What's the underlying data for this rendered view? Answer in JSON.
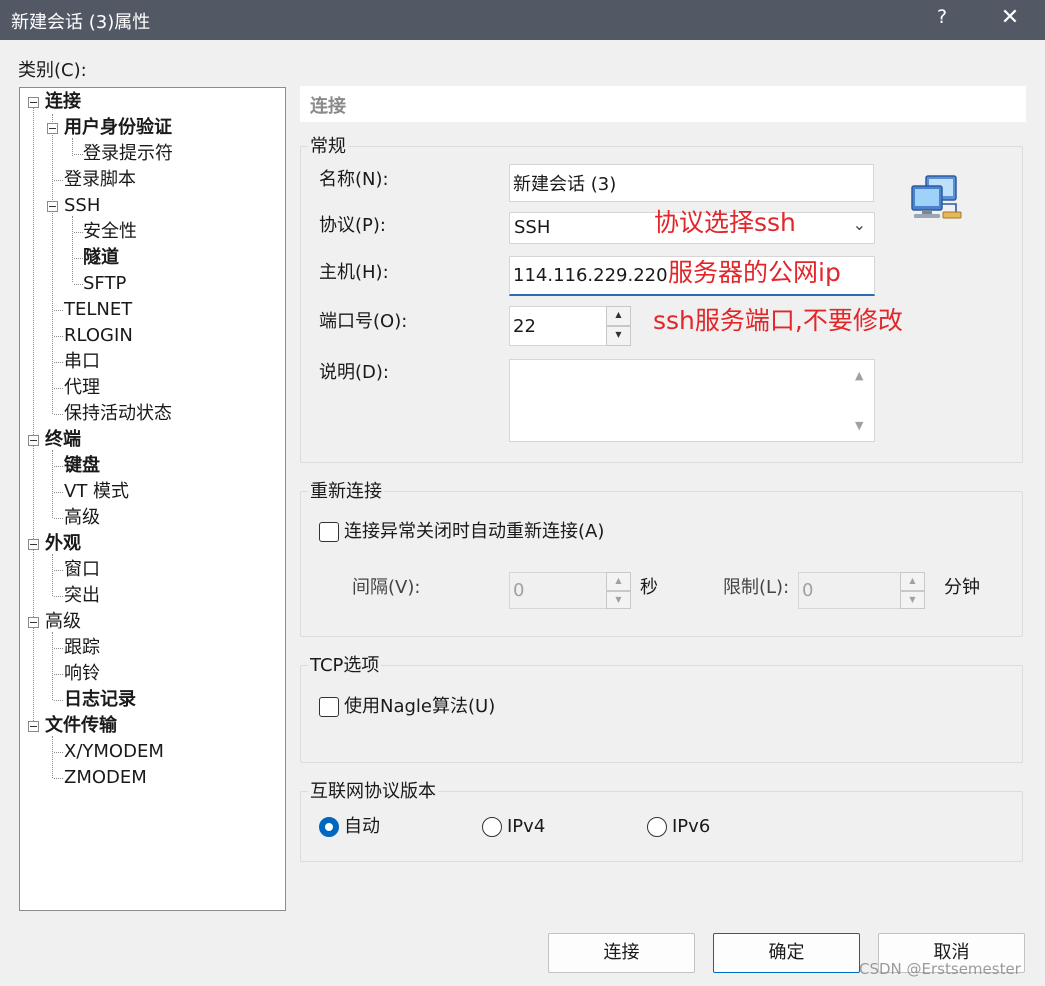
{
  "window": {
    "title": "新建会话 (3)属性",
    "help_label": "?",
    "close_label": "✕"
  },
  "category_label": "类别(C):",
  "tree": {
    "connection": "连接",
    "auth": "用户身份验证",
    "login_prompt": "登录提示符",
    "login_script": "登录脚本",
    "ssh": "SSH",
    "security": "安全性",
    "tunnel": "隧道",
    "sftp": "SFTP",
    "telnet": "TELNET",
    "rlogin": "RLOGIN",
    "serial": "串口",
    "proxy": "代理",
    "keepalive": "保持活动状态",
    "terminal": "终端",
    "keyboard": "键盘",
    "vt_mode": "VT 模式",
    "term_advanced": "高级",
    "appearance": "外观",
    "window": "窗口",
    "highlight": "突出",
    "advanced": "高级",
    "trace": "跟踪",
    "bell": "响铃",
    "logging": "日志记录",
    "file_transfer": "文件传输",
    "xymodem": "X/YMODEM",
    "zmodem": "ZMODEM"
  },
  "page": {
    "header": "连接",
    "general": {
      "legend": "常规",
      "name_label": "名称(N):",
      "name_value": "新建会话 (3)",
      "protocol_label": "协议(P):",
      "protocol_value": "SSH",
      "host_label": "主机(H):",
      "host_value": "114.116.229.220",
      "port_label": "端口号(O):",
      "port_value": "22",
      "desc_label": "说明(D):",
      "desc_value": ""
    },
    "reconnect": {
      "legend": "重新连接",
      "auto_reconnect_label": "连接异常关闭时自动重新连接(A)",
      "auto_reconnect_checked": false,
      "interval_label": "间隔(V):",
      "interval_value": "0",
      "interval_unit": "秒",
      "limit_label": "限制(L):",
      "limit_value": "0",
      "limit_unit": "分钟"
    },
    "tcp": {
      "legend": "TCP选项",
      "nagle_label": "使用Nagle算法(U)",
      "nagle_checked": false
    },
    "ip_version": {
      "legend": "互联网协议版本",
      "options": [
        "自动",
        "IPv4",
        "IPv6"
      ],
      "selected": "自动"
    }
  },
  "annotations": {
    "protocol_note": "协议选择ssh",
    "host_note": "服务器的公网ip",
    "port_note": "ssh服务端口,不要修改",
    "color": "#e2262a"
  },
  "buttons": {
    "connect": "连接",
    "ok": "确定",
    "cancel": "取消"
  },
  "watermark": "CSDN @Erstsemester",
  "icons": {
    "network": "network-computers-icon",
    "dropdown": "chevron-down-icon",
    "close": "close-icon",
    "help": "help-icon"
  }
}
